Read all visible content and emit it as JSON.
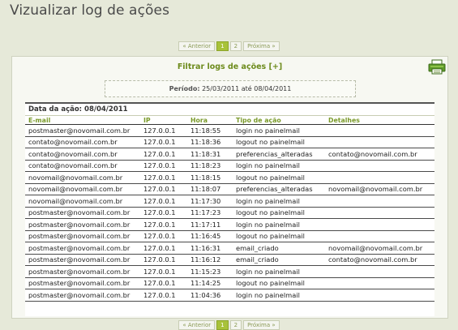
{
  "page": {
    "title": "Vizualizar log de ações"
  },
  "pager": {
    "prev": "« Anterior",
    "pages": [
      "1",
      "2"
    ],
    "next": "Próxima »",
    "current": "1"
  },
  "filter": {
    "title": "Filtrar logs de ações [+]",
    "print_icon": "printer-icon"
  },
  "period": {
    "label": "Período:",
    "start": "25/03/2011",
    "sep": "até",
    "end": "08/04/2011"
  },
  "log": {
    "date_label": "Data da ação: 08/04/2011",
    "columns": [
      "E-mail",
      "IP",
      "Hora",
      "Tipo de ação",
      "Detalhes"
    ],
    "rows": [
      [
        "postmaster@novomail.com.br",
        "127.0.0.1",
        "11:18:55",
        "login no painelmail",
        ""
      ],
      [
        "contato@novomail.com.br",
        "127.0.0.1",
        "11:18:36",
        "logout no painelmail",
        ""
      ],
      [
        "contato@novomail.com.br",
        "127.0.0.1",
        "11:18:31",
        "preferencias_alteradas",
        "contato@novomail.com.br"
      ],
      [
        "contato@novomail.com.br",
        "127.0.0.1",
        "11:18:23",
        "login no painelmail",
        ""
      ],
      [
        "novomail@novomail.com.br",
        "127.0.0.1",
        "11:18:15",
        "logout no painelmail",
        ""
      ],
      [
        "novomail@novomail.com.br",
        "127.0.0.1",
        "11:18:07",
        "preferencias_alteradas",
        "novomail@novomail.com.br"
      ],
      [
        "novomail@novomail.com.br",
        "127.0.0.1",
        "11:17:30",
        "login no painelmail",
        ""
      ],
      [
        "postmaster@novomail.com.br",
        "127.0.0.1",
        "11:17:23",
        "logout no painelmail",
        ""
      ],
      [
        "postmaster@novomail.com.br",
        "127.0.0.1",
        "11:17:11",
        "login no painelmail",
        ""
      ],
      [
        "postmaster@novomail.com.br",
        "127.0.0.1",
        "11:16:45",
        "logout no painelmail",
        ""
      ],
      [
        "postmaster@novomail.com.br",
        "127.0.0.1",
        "11:16:31",
        "email_criado",
        "novomail@novomail.com.br"
      ],
      [
        "postmaster@novomail.com.br",
        "127.0.0.1",
        "11:16:12",
        "email_criado",
        "contato@novomail.com.br"
      ],
      [
        "postmaster@novomail.com.br",
        "127.0.0.1",
        "11:15:23",
        "login no painelmail",
        ""
      ],
      [
        "postmaster@novomail.com.br",
        "127.0.0.1",
        "11:14:25",
        "logout no painelmail",
        ""
      ],
      [
        "postmaster@novomail.com.br",
        "127.0.0.1",
        "11:04:36",
        "login no painelmail",
        ""
      ]
    ]
  }
}
